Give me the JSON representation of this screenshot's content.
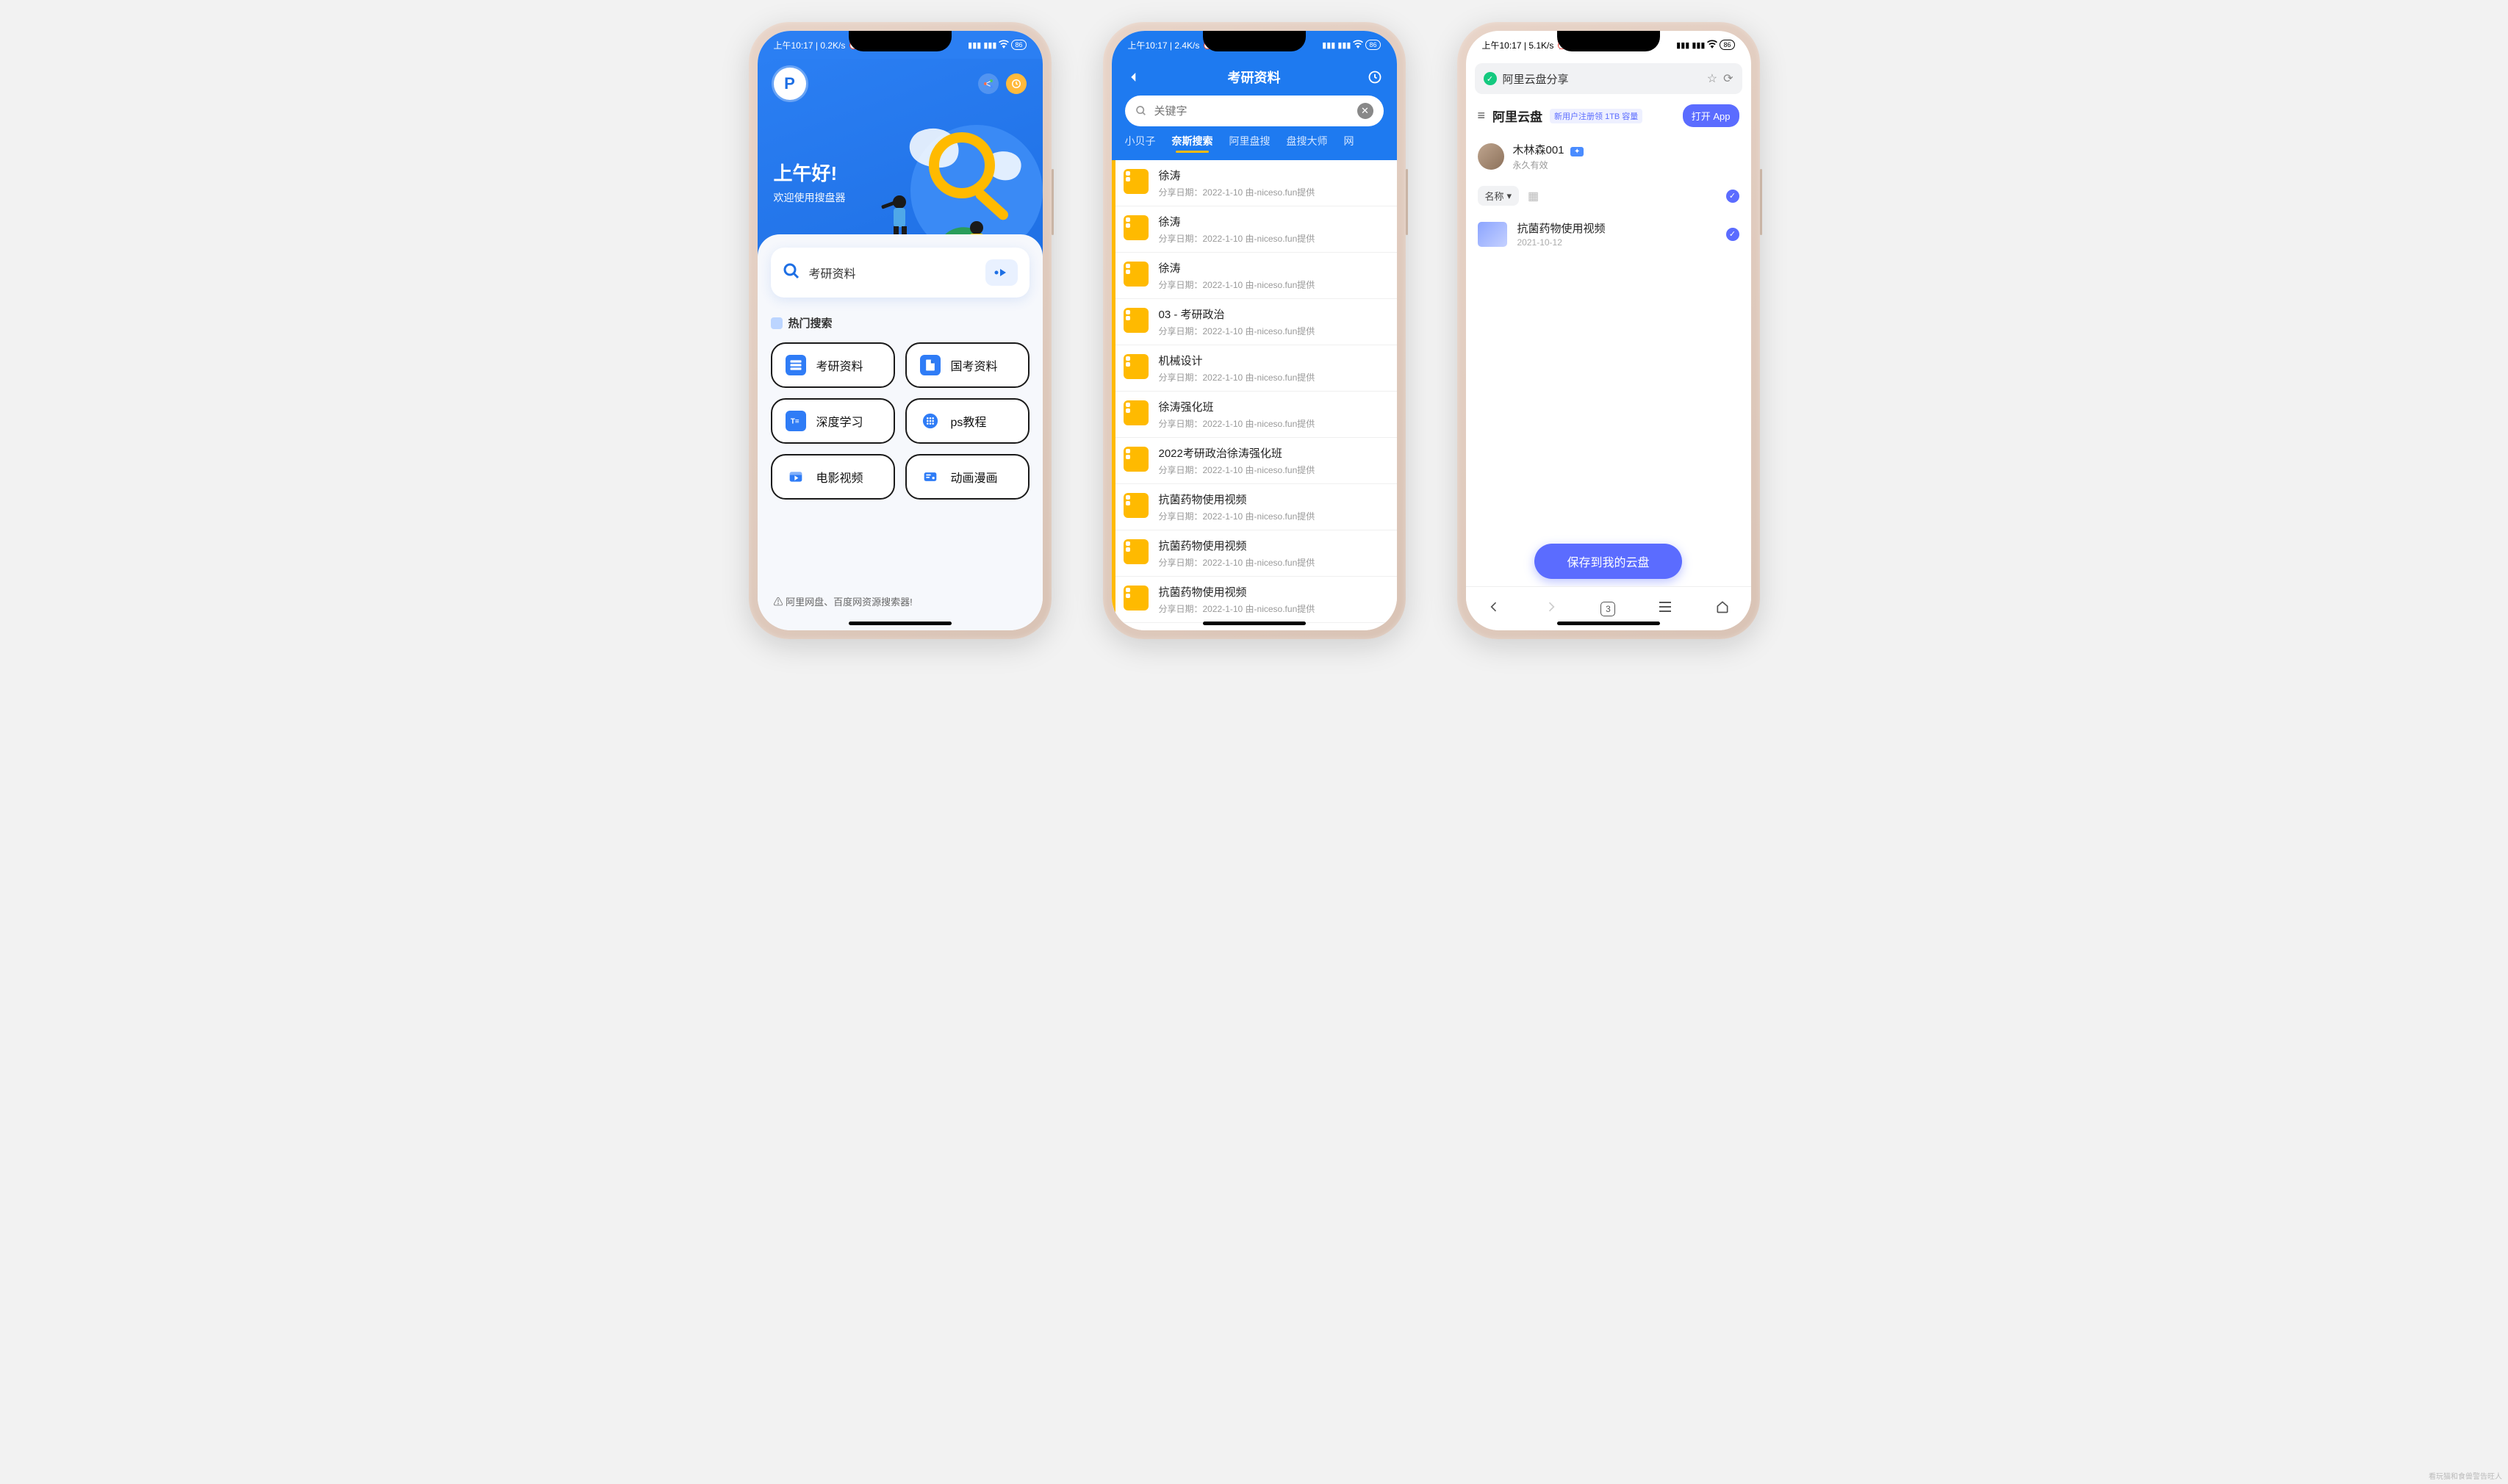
{
  "status": {
    "p1": "上午10:17 | 0.2K/s",
    "p2": "上午10:17 | 2.4K/s",
    "p3": "上午10:17 | 5.1K/s",
    "battery": "86"
  },
  "phone1": {
    "greeting_title": "上午好!",
    "greeting_sub": "欢迎使用搜盘器",
    "search_value": "考研资料",
    "hot_label": "热门搜索",
    "chips": [
      {
        "label": "考研资料",
        "color": "#2f7cf6"
      },
      {
        "label": "国考资料",
        "color": "#2f7cf6"
      },
      {
        "label": "深度学习",
        "color": "#2f7cf6"
      },
      {
        "label": "ps教程",
        "color": "#2f7cf6"
      },
      {
        "label": "电影视频",
        "color": "#2f7cf6"
      },
      {
        "label": "动画漫画",
        "color": "#2f7cf6"
      }
    ],
    "footer": "⚠ 阿里网盘、百度网资源搜索器!"
  },
  "phone2": {
    "title": "考研资料",
    "search_placeholder": "关键字",
    "tabs": [
      "小贝子",
      "奈斯搜索",
      "阿里盘搜",
      "盘搜大师",
      "网"
    ],
    "active_tab": 1,
    "items": [
      {
        "name": "徐涛",
        "meta": "分享日期：2022-1-10 由-niceso.fun提供"
      },
      {
        "name": "徐涛",
        "meta": "分享日期：2022-1-10 由-niceso.fun提供"
      },
      {
        "name": "徐涛",
        "meta": "分享日期：2022-1-10 由-niceso.fun提供"
      },
      {
        "name": "03 - 考研政治",
        "meta": "分享日期：2022-1-10 由-niceso.fun提供"
      },
      {
        "name": "机械设计",
        "meta": "分享日期：2022-1-10 由-niceso.fun提供"
      },
      {
        "name": "徐涛强化班",
        "meta": "分享日期：2022-1-10 由-niceso.fun提供"
      },
      {
        "name": "2022考研政治徐涛强化班",
        "meta": "分享日期：2022-1-10 由-niceso.fun提供"
      },
      {
        "name": "抗菌药物使用视频",
        "meta": "分享日期：2022-1-10 由-niceso.fun提供"
      },
      {
        "name": "抗菌药物使用视频",
        "meta": "分享日期：2022-1-10 由-niceso.fun提供"
      },
      {
        "name": "抗菌药物使用视频",
        "meta": "分享日期：2022-1-10 由-niceso.fun提供"
      }
    ]
  },
  "phone3": {
    "address": "阿里云盘分享",
    "brand": "阿里云盘",
    "promo": "新用户注册领 1TB 容量",
    "open_btn": "打开 App",
    "username": "木林森001",
    "validity": "永久有效",
    "sort_label": "名称",
    "file": {
      "name": "抗菌药物使用视频",
      "date": "2021-10-12"
    },
    "save_btn": "保存到我的云盘",
    "tab_count": "3"
  },
  "watermark": "看玩猫和食兽警告旺人"
}
